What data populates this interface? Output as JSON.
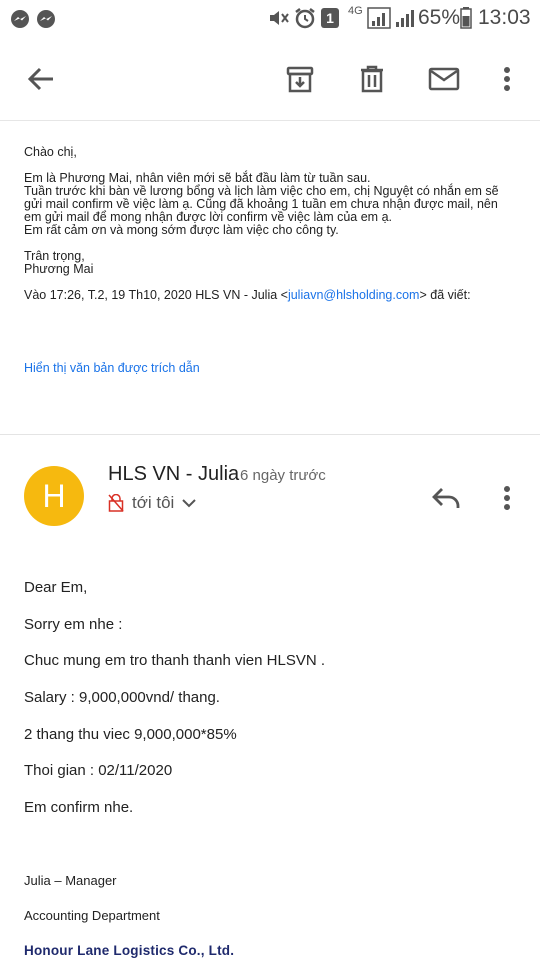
{
  "status_bar": {
    "battery": "65%",
    "time": "13:03",
    "network": "4G"
  },
  "toolbar": {
    "back": "back-arrow-icon",
    "archive": "archive-icon",
    "delete": "trash-icon",
    "mark_unread": "mail-icon",
    "more": "more-vert-icon"
  },
  "quoted": {
    "greeting": "Chào chị,",
    "para_lines": [
      "Em là Phương Mai, nhân viên mới sẽ bắt đầu làm từ tuần sau.",
      "Tuần trước khi bàn về lương bổng và lịch làm việc cho em, chị Nguyệt có nhắn em sẽ",
      "gửi mail confirm về việc làm ạ. Cũng đã khoảng 1 tuần em chưa nhận được mail, nên",
      "em gửi mail để mong nhận được lời confirm về việc làm của em ạ.",
      "Em rất cảm ơn và mong sớm được làm việc cho công ty."
    ],
    "closing": "Trân trọng,",
    "name": "Phương Mai",
    "header_prefix": "Vào 17:26, T.2, 19 Th10, 2020 HLS VN - Julia <",
    "header_email": "juliavn@hlsholding.com",
    "header_suffix": "> đã viết:",
    "show_quoted": "Hiển thị văn bản được trích dẫn"
  },
  "message": {
    "avatar_letter": "H",
    "avatar_color": "#f6b90f",
    "sender": "HLS VN - Julia",
    "when": "6 ngày trước",
    "to": "tới tôi",
    "body": [
      "Dear Em,",
      "Sorry em nhe :",
      "Chuc mung em tro thanh thanh vien HLSVN .",
      "Salary : 9,000,000vnd/ thang.",
      "2 thang thu viec 9,000,000*85%",
      "Thoi gian : 02/11/2020",
      "Em confirm nhe."
    ],
    "signature": {
      "name": "Julia – Manager",
      "dept": "Accounting Department",
      "company": "Honour Lane Logistics Co., Ltd."
    }
  }
}
